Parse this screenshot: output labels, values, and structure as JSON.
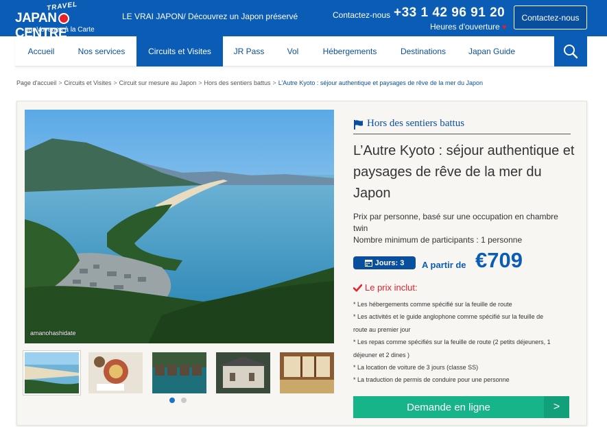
{
  "header": {
    "logo_travel": "TRAVEL",
    "logo_left": "JAPAN",
    "logo_right": "CENTRE",
    "logo_sub": "par Voyages à la Carte",
    "tagline": "LE VRAI JAPON/ Découvrez un Japon préservé",
    "contact_label": "Contactez-nous",
    "phone": "+33 1 42 96 91 20",
    "hours": "Heures d'ouverture",
    "contact_button": "Contactez-nous",
    "colors": {
      "brand_blue": "#0a5cb5",
      "accent_red": "#e8202a"
    }
  },
  "nav": {
    "items": [
      {
        "label": "Accueil"
      },
      {
        "label": "Nos services"
      },
      {
        "label": "Circuits et Visites"
      },
      {
        "label": "JR Pass"
      },
      {
        "label": "Vol"
      },
      {
        "label": "Hébergements"
      },
      {
        "label": "Destinations"
      },
      {
        "label": "Japan Guide"
      }
    ],
    "active": "Circuits et Visites",
    "search_icon": "search-icon"
  },
  "breadcrumb": {
    "items": [
      "Page d'accueil",
      "Circuits et Visites",
      "Circuit sur mesure au Japon",
      "Hors des sentiers battus",
      "L’Autre Kyoto : séjour authentique et paysages de rêve de la mer du Japon"
    ],
    "separator": ">"
  },
  "tour": {
    "image_caption": "amanohashidate",
    "category": "Hors des sentiers battus",
    "title": "L’Autre Kyoto : séjour authentique et paysages de rêve de la mer du Japon",
    "price_basis": "Prix par personne, basé sur une occupation en chambre twin",
    "min_participants": "Nombre minimum de participants : 1 personne",
    "days_label": "Jours: 3",
    "from_label": "A partir de",
    "price": "€709",
    "included_title": "Le prix inclut:",
    "included": [
      "* Les hébergements comme spécifié sur la feuille de route",
      "* Les activités et le guide anglophone comme spécifié sur la feuille de route au premier jour",
      "* Les repas comme spécifiés sur la feuille de route (2 petits déjeuners, 1 déjeuner et 2 dines )",
      "* La location de voiture de 3 jours (classe SS)",
      "* La traduction de permis de conduire pour une personne"
    ],
    "request_button": "Demande en ligne",
    "request_arrow": ">",
    "carousel": {
      "slides": 2,
      "active_slide": 1
    }
  }
}
